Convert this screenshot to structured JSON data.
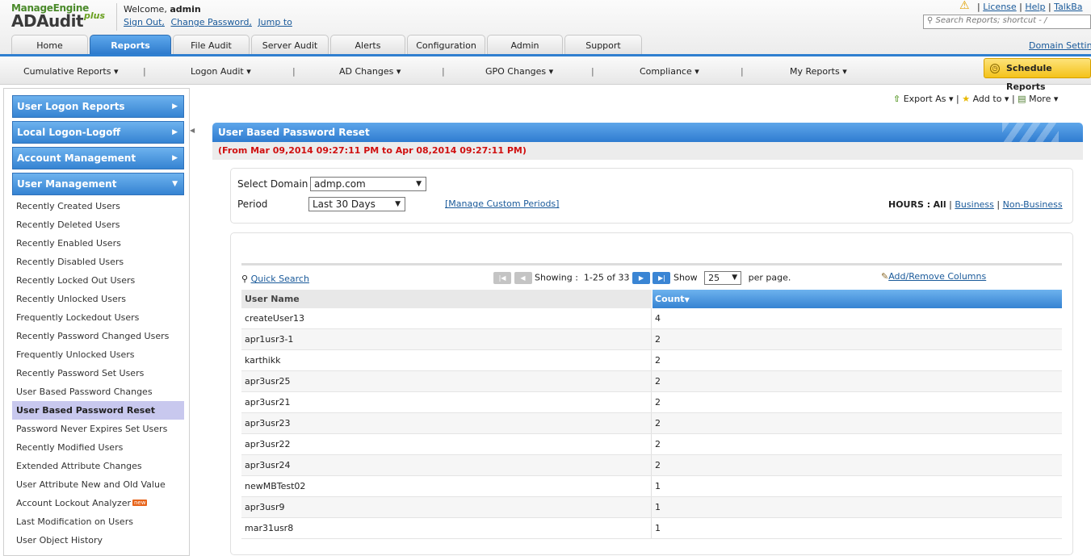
{
  "header": {
    "logo_brand": "ManageEngine",
    "logo_product": "ADAudit",
    "logo_plus": "plus",
    "welcome_prefix": "Welcome,",
    "welcome_user": "admin",
    "links": [
      "Sign Out,",
      "Change Password,",
      "Jump to"
    ],
    "right_links": [
      "License",
      "Help",
      "TalkBa"
    ],
    "search_placeholder": "Search Reports; shortcut - /",
    "domain_settings": "Domain Settin"
  },
  "tabs": [
    "Home",
    "Reports",
    "File Audit",
    "Server Audit",
    "Alerts",
    "Configuration",
    "Admin",
    "Support"
  ],
  "active_tab": "Reports",
  "subnav": [
    "Cumulative Reports",
    "Logon Audit",
    "AD Changes",
    "GPO Changes",
    "Compliance",
    "My Reports"
  ],
  "schedule_reports": "Schedule Reports",
  "sidebar": {
    "categories": [
      "User Logon Reports",
      "Local Logon-Logoff",
      "Account Management",
      "User Management"
    ],
    "items": [
      "Recently Created Users",
      "Recently Deleted Users",
      "Recently Enabled Users",
      "Recently Disabled Users",
      "Recently Locked Out Users",
      "Recently Unlocked Users",
      "Frequently Lockedout Users",
      "Recently Password Changed Users",
      "Frequently Unlocked Users",
      "Recently Password Set Users",
      "User Based Password Changes",
      "User Based Password Reset",
      "Password Never Expires Set Users",
      "Recently Modified Users",
      "Extended Attribute Changes",
      "User Attribute New and Old Value",
      "Account Lockout Analyzer",
      "Last Modification on Users",
      "User Object History"
    ],
    "selected_item": "User Based Password Reset",
    "new_badge": "new"
  },
  "toolbar": {
    "export": "Export As",
    "add_to": "Add to",
    "more": "More"
  },
  "report": {
    "title": "User Based Password Reset",
    "date_range": "(From Mar 09,2014 09:27:11 PM to Apr 08,2014 09:27:11 PM)",
    "select_domain_label": "Select Domain",
    "domain_value": "admp.com",
    "period_label": "Period",
    "period_value": "Last 30 Days",
    "manage_periods": "[Manage Custom Periods]",
    "hours_label": "HOURS :",
    "hours_all": "All",
    "hours_business": "Business",
    "hours_nonbusiness": "Non-Business"
  },
  "grid": {
    "quick_search": "Quick Search",
    "showing_label": "Showing :",
    "showing_range": "1-25 of 33",
    "show_label": "Show",
    "per_page_value": "25",
    "per_page_label": "per page.",
    "add_remove_columns": "Add/Remove Columns",
    "columns": [
      "User Name",
      "Count"
    ],
    "rows": [
      [
        "createUser13",
        "4"
      ],
      [
        "apr1usr3-1",
        "2"
      ],
      [
        "karthikk",
        "2"
      ],
      [
        "apr3usr25",
        "2"
      ],
      [
        "apr3usr21",
        "2"
      ],
      [
        "apr3usr23",
        "2"
      ],
      [
        "apr3usr22",
        "2"
      ],
      [
        "apr3usr24",
        "2"
      ],
      [
        "newMBTest02",
        "1"
      ],
      [
        "apr3usr9",
        "1"
      ],
      [
        "mar31usr8",
        "1"
      ]
    ]
  }
}
